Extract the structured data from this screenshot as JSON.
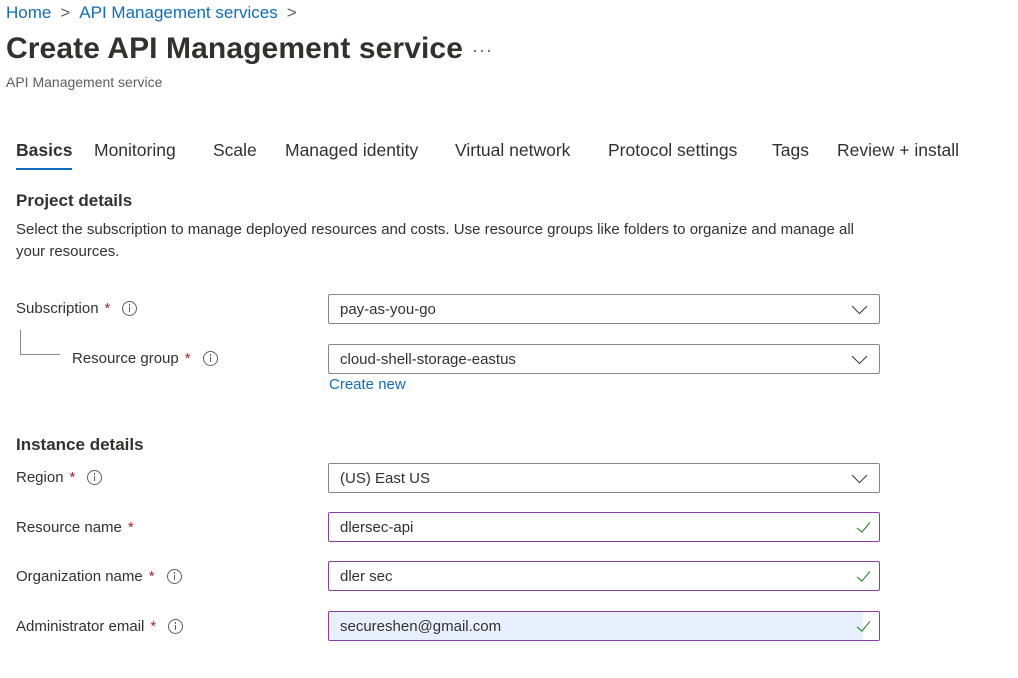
{
  "breadcrumb": {
    "items": [
      "Home",
      "API Management services"
    ],
    "separator": ">"
  },
  "header": {
    "title": "Create API Management service",
    "more": "···",
    "subtitle": "API Management service"
  },
  "tabs": [
    {
      "label": "Basics",
      "active": true
    },
    {
      "label": "Monitoring",
      "active": false
    },
    {
      "label": "Scale",
      "active": false
    },
    {
      "label": "Managed identity",
      "active": false
    },
    {
      "label": "Virtual network",
      "active": false
    },
    {
      "label": "Protocol settings",
      "active": false
    },
    {
      "label": "Tags",
      "active": false
    },
    {
      "label": "Review + install",
      "active": false
    }
  ],
  "project": {
    "title": "Project details",
    "description": "Select the subscription to manage deployed resources and costs. Use resource groups like folders to organize and manage all your resources.",
    "subscription": {
      "label": "Subscription",
      "required": "*",
      "value": "pay-as-you-go"
    },
    "resource_group": {
      "label": "Resource group",
      "required": "*",
      "value": "cloud-shell-storage-eastus",
      "create_new": "Create new"
    }
  },
  "instance": {
    "title": "Instance details",
    "region": {
      "label": "Region",
      "required": "*",
      "value": "(US) East US"
    },
    "resource_name": {
      "label": "Resource name",
      "required": "*",
      "value": "dlersec-api"
    },
    "organization_name": {
      "label": "Organization name",
      "required": "*",
      "value": "dler sec"
    },
    "admin_email": {
      "label": "Administrator email",
      "required": "*",
      "value": "secureshen@gmail.com"
    }
  },
  "colors": {
    "link": "#0f6cbd",
    "required": "#a4262c",
    "valid_border": "#8a3ea3",
    "valid_check": "#107c10"
  }
}
